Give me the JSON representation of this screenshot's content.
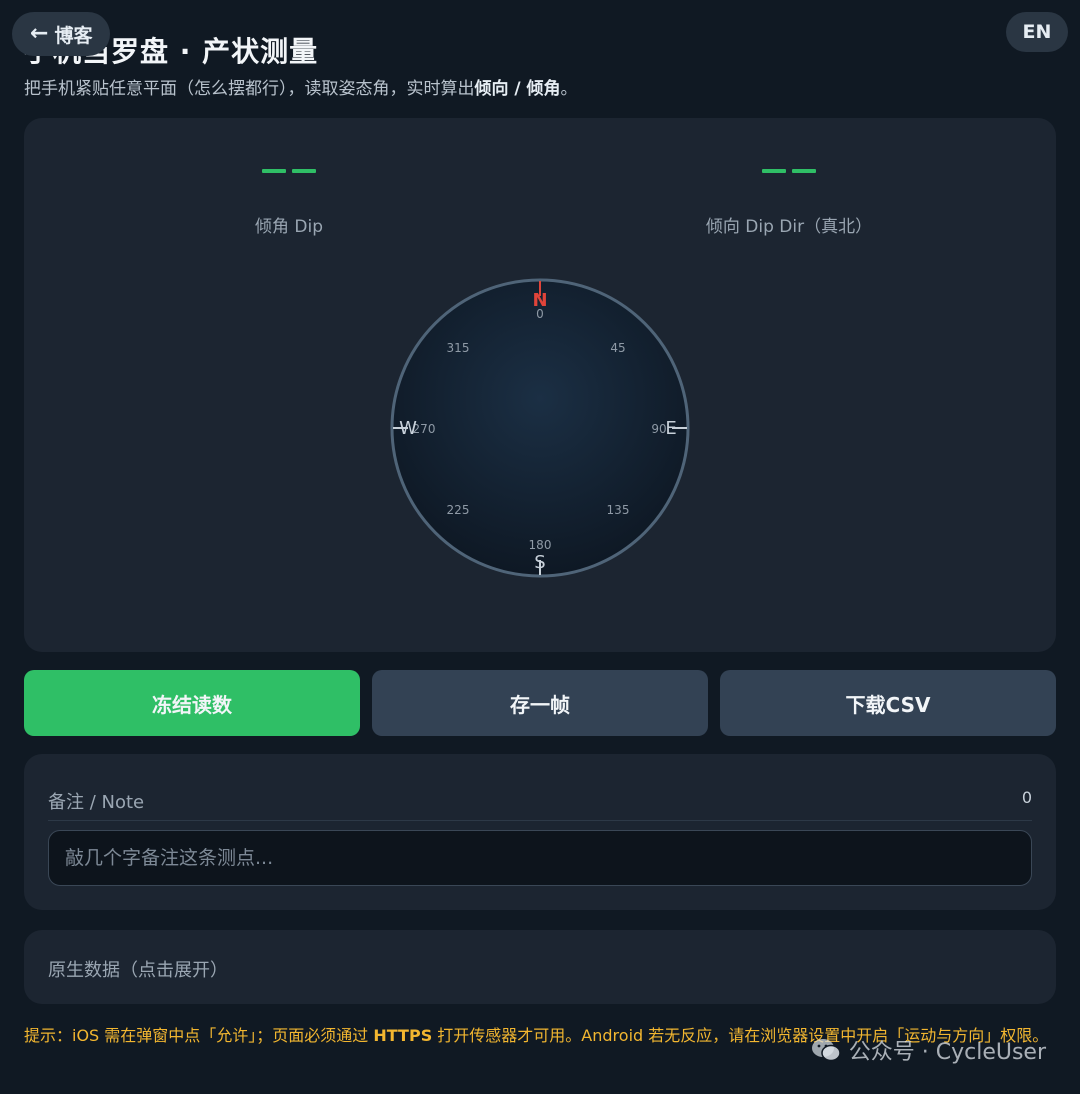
{
  "header": {
    "back_label": "博客",
    "lang_label": "EN",
    "title": "手机当罗盘 · 产状测量",
    "subtitle_prefix": "把手机紧贴任意平面（怎么摆都行），读取姿态角，实时算出",
    "subtitle_em1": "倾向",
    "subtitle_sep": " / ",
    "subtitle_em2": "倾角",
    "subtitle_suffix": "。"
  },
  "readings": {
    "dip_label": "倾角 Dip",
    "dip_dir_label": "倾向 Dip Dir（真北）"
  },
  "compass": {
    "cardinals": {
      "n": "N",
      "e": "E",
      "s": "S",
      "w": "W"
    },
    "degrees": [
      "0",
      "45",
      "90",
      "135",
      "180",
      "225",
      "270",
      "315"
    ],
    "north_color": "#e0443a",
    "accent_color": "#2fbf66"
  },
  "actions": {
    "freeze_label": "冻结读数",
    "save_label": "存一帧",
    "csv_label": "下载CSV"
  },
  "note": {
    "label": "备注 / Note",
    "count": "0",
    "placeholder": "敲几个字备注这条测点..."
  },
  "raw": {
    "label": "原生数据（点击展开）"
  },
  "tip": {
    "prefix": "提示：iOS 需在弹窗中点「允许」；页面必须通过 ",
    "em": "HTTPS",
    "suffix": " 打开传感器才可用。Android 若无反应，请在浏览器设置中开启「运动与方向」权限。"
  },
  "watermark": {
    "text": "公众号 · CycleUser"
  }
}
